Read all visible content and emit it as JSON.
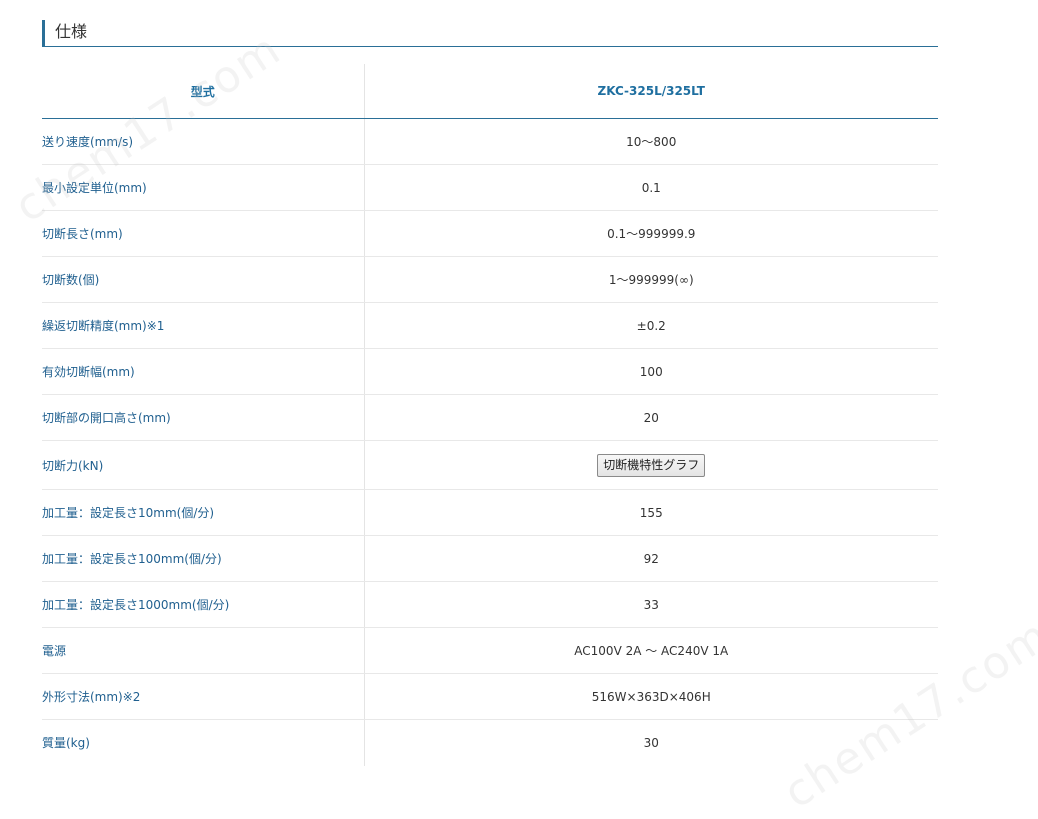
{
  "section": {
    "title": "仕様"
  },
  "table": {
    "header": {
      "label": "型式",
      "value": "ZKC-325L/325LT"
    },
    "rows": [
      {
        "label": "送り速度(mm/s)",
        "value": "10～800"
      },
      {
        "label": "最小設定単位(mm)",
        "value": "0.1"
      },
      {
        "label": "切断長さ(mm)",
        "value": "0.1～999999.9"
      },
      {
        "label": "切断数(個)",
        "value": "1～999999(∞)"
      },
      {
        "label": "繰返切断精度(mm)※1",
        "value": "±0.2"
      },
      {
        "label": "有効切断幅(mm)",
        "value": "100"
      },
      {
        "label": "切断部の開口高さ(mm)",
        "value": "20"
      },
      {
        "label": "切断力(kN)",
        "button": "切断機特性グラフ"
      },
      {
        "label": "加工量：設定長さ10mm(個/分)",
        "value": "155"
      },
      {
        "label": "加工量：設定長さ100mm(個/分)",
        "value": "92"
      },
      {
        "label": "加工量：設定長さ1000mm(個/分)",
        "value": "33"
      },
      {
        "label": "電源",
        "value": "AC100V 2A 〜 AC240V 1A"
      },
      {
        "label": "外形寸法(mm)※2",
        "value": "516W×363D×406H"
      },
      {
        "label": "質量(kg)",
        "value": "30"
      }
    ]
  },
  "watermark": "chem17.com",
  "colors": {
    "accent": "#2a6f97",
    "label_text": "#1f5f8f",
    "header_text": "#1f6fa0",
    "row_divider": "#e8e8e8"
  }
}
